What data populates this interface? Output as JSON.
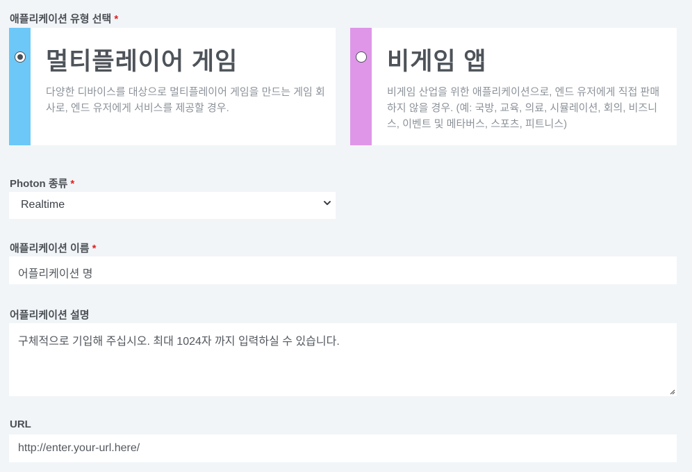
{
  "app_type": {
    "label": "애플리케이션 유형 선택",
    "required_mark": "*",
    "options": [
      {
        "title": "멀티플레이어 게임",
        "description": "다양한 디바이스를 대상으로 멀티플레이어 게임을 만드는 게임 회사로, 엔드 유저에게 서비스를 제공할 경우.",
        "selected": true,
        "accent_color": "#6dc8f8"
      },
      {
        "title": "비게임 앱",
        "description": "비게임 산업을 위한 애플리케이션으로, 엔드 유저에게 직접 판매하지 않을 경우. (예: 국방, 교육, 의료, 시뮬레이션, 회의, 비즈니스, 이벤트 및 메타버스, 스포츠, 피트니스)",
        "selected": false,
        "accent_color": "#df96e9"
      }
    ]
  },
  "photon_type": {
    "label": "Photon 종류",
    "required_mark": "*",
    "selected_value": "Realtime",
    "icon": "chevron-down-icon"
  },
  "app_name": {
    "label": "애플리케이션 이름",
    "required_mark": "*",
    "placeholder": "어플리케이션 명"
  },
  "app_description": {
    "label": "어플리케이션 설명",
    "placeholder": "구체적으로 기입해 주십시오. 최대 1024자 까지 입력하실 수 있습니다."
  },
  "url": {
    "label": "URL",
    "placeholder": "http://enter.your-url.here/"
  },
  "colors": {
    "background": "#f1f5f8",
    "required": "#e02020"
  }
}
